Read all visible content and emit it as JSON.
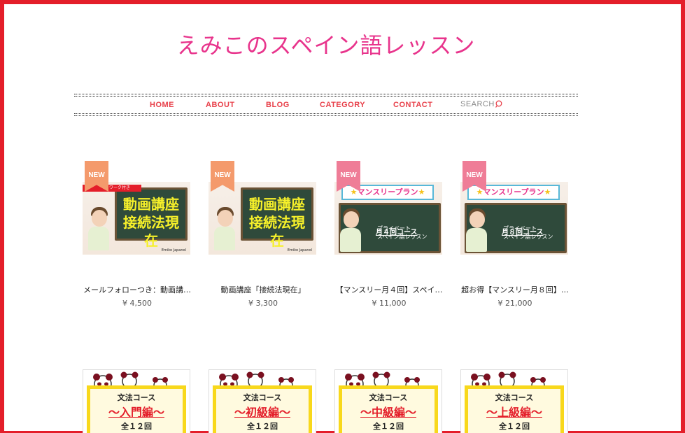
{
  "site": {
    "title": "えみこのスペイン語レッスン"
  },
  "nav": {
    "items": [
      "HOME",
      "ABOUT",
      "BLOG",
      "CATEGORY",
      "CONTACT"
    ],
    "search_label": "SEARCH"
  },
  "products": [
    {
      "badge": "NEW",
      "badge_color": "#f49a6c",
      "strip_text": "ワーク付き",
      "board_lines": [
        "動画講座",
        "接続法現在"
      ],
      "credit": "Emiko Japanol",
      "name": "メールフォローつき：動画講…",
      "price": "¥ 4,500"
    },
    {
      "badge": "NEW",
      "badge_color": "#f49a6c",
      "board_lines": [
        "動画講座",
        "接続法現在"
      ],
      "credit": "Emiko Japanol",
      "name": "動画講座「接続法現在」",
      "price": "¥ 3,300"
    },
    {
      "badge": "NEW",
      "badge_color": "#ef7d97",
      "plan_title": "マンスリープラン",
      "plan_sub": "月４回コース",
      "plan_desc": [
        "プライベート",
        "スペイン語レッスン"
      ],
      "name": "【マンスリー月４回】スペイ…",
      "price": "¥ 11,000"
    },
    {
      "badge": "NEW",
      "badge_color": "#ef7d97",
      "plan_title": "マンスリープラン",
      "plan_sub": "月８回コース",
      "plan_desc": [
        "プライベート",
        "スペイン語レッスン"
      ],
      "name": "超お得【マンスリー月８回】…",
      "price": "¥ 21,000"
    }
  ],
  "grammar_courses": [
    {
      "title": "文法コース",
      "level": "〜入門編〜",
      "count": "全１２回"
    },
    {
      "title": "文法コース",
      "level": "〜初級編〜",
      "count": "全１２回"
    },
    {
      "title": "文法コース",
      "level": "〜中級編〜",
      "count": "全１２回"
    },
    {
      "title": "文法コース",
      "level": "〜上級編〜",
      "count": "全１２回"
    }
  ],
  "colors": {
    "accent": "#e8348c",
    "border": "#e41e2a",
    "nav": "#e8404a"
  }
}
